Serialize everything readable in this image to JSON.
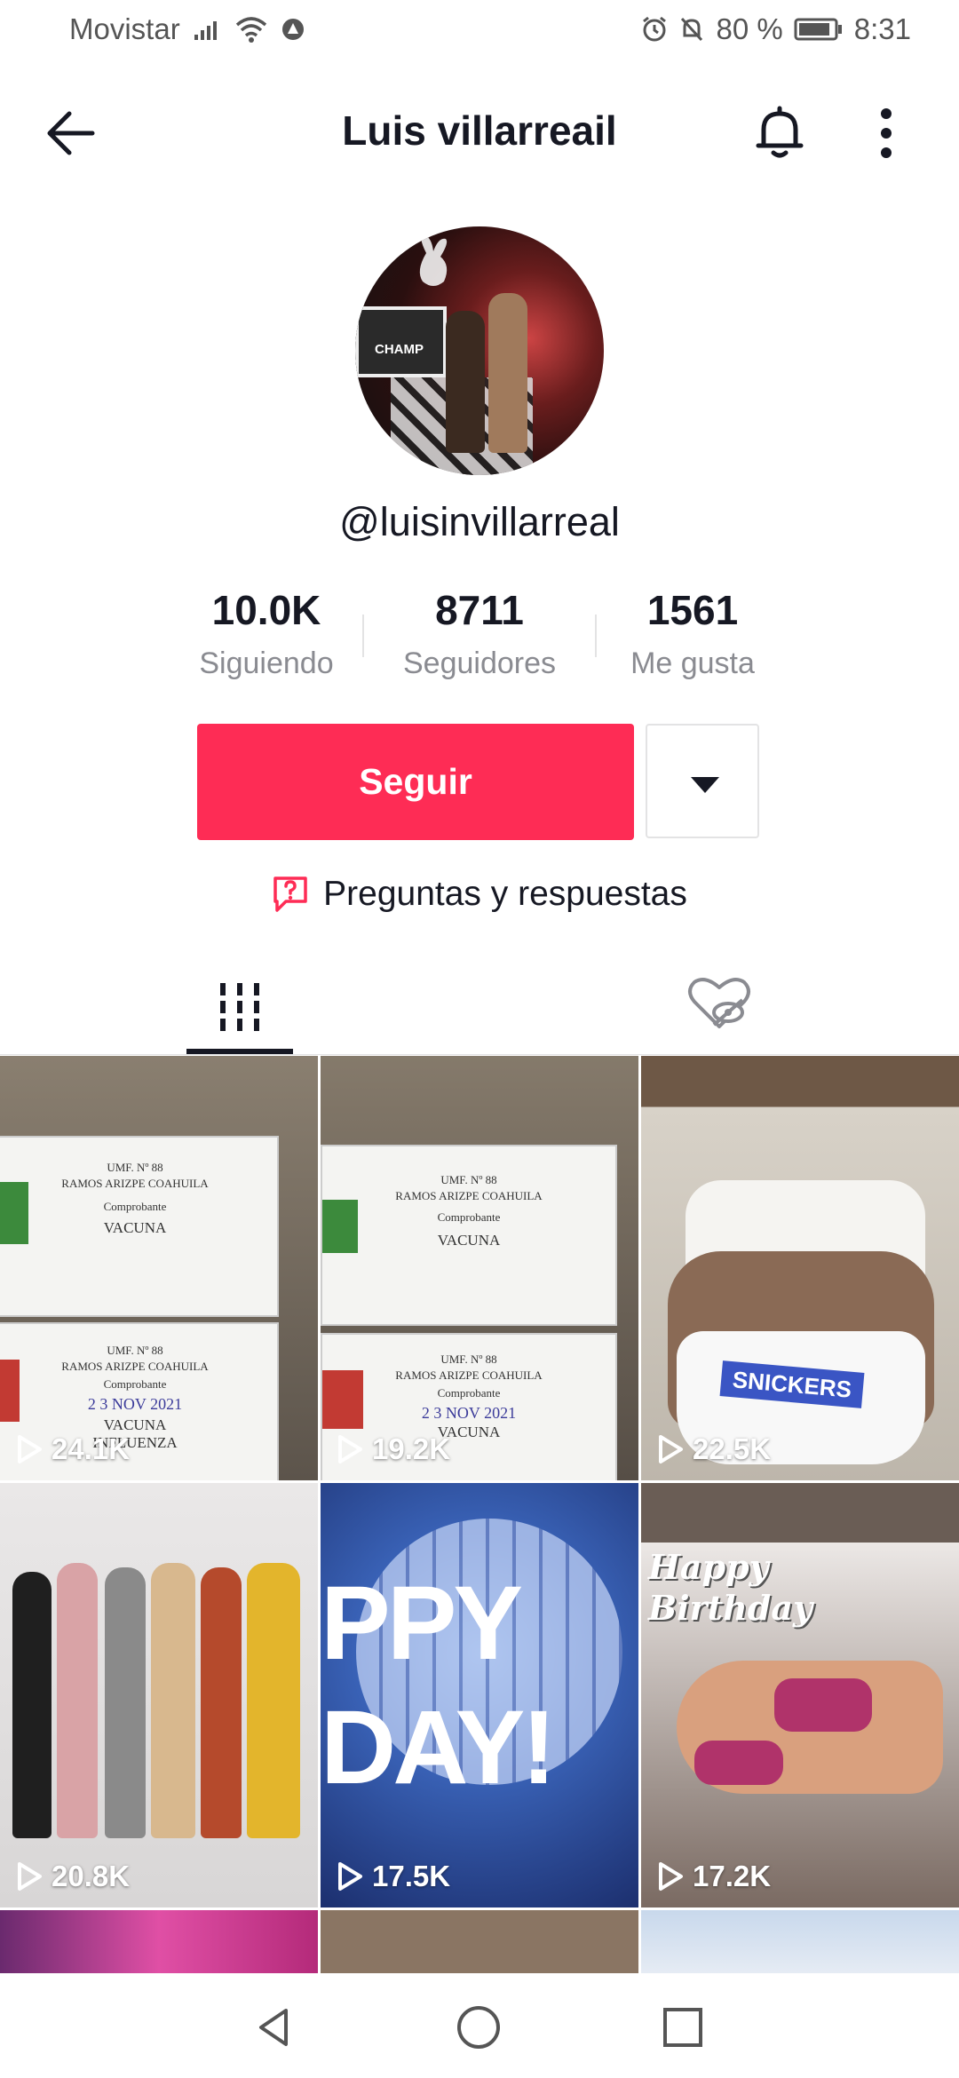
{
  "status_bar": {
    "carrier": "Movistar",
    "battery_percent": "80 %",
    "time": "8:31"
  },
  "header": {
    "title": "Luis villarreail"
  },
  "profile": {
    "handle": "@luisinvillarreal",
    "stats": [
      {
        "value": "10.0K",
        "label": "Siguiendo"
      },
      {
        "value": "8711",
        "label": "Seguidores"
      },
      {
        "value": "1561",
        "label": "Me gusta"
      }
    ],
    "follow_label": "Seguir",
    "qa_label": "Preguntas y respuestas"
  },
  "videos": [
    {
      "views": "24.1K"
    },
    {
      "views": "19.2K"
    },
    {
      "views": "22.5K"
    },
    {
      "views": "20.8K"
    },
    {
      "views": "17.5K"
    },
    {
      "views": "17.2K"
    }
  ],
  "thumb_text": {
    "doc_clinic": "UMF. Nº 88",
    "doc_place": "RAMOS ARIZPE COAHUILA",
    "doc_comprobante": "Comprobante",
    "doc_vacuna": "VACUNA",
    "doc_influenza": "INFLUENZA",
    "doc_stamp": "2 3 NOV 2021",
    "brand": "SNICKERS",
    "disco_top": "PPY",
    "disco_bottom": "DAY!",
    "birthday_line1": "Happy",
    "birthday_line2": "Birthday",
    "sign_text": "CHAMP"
  },
  "colors": {
    "accent": "#fe2c55",
    "text_primary": "#161823",
    "text_secondary": "#8a8b91"
  }
}
